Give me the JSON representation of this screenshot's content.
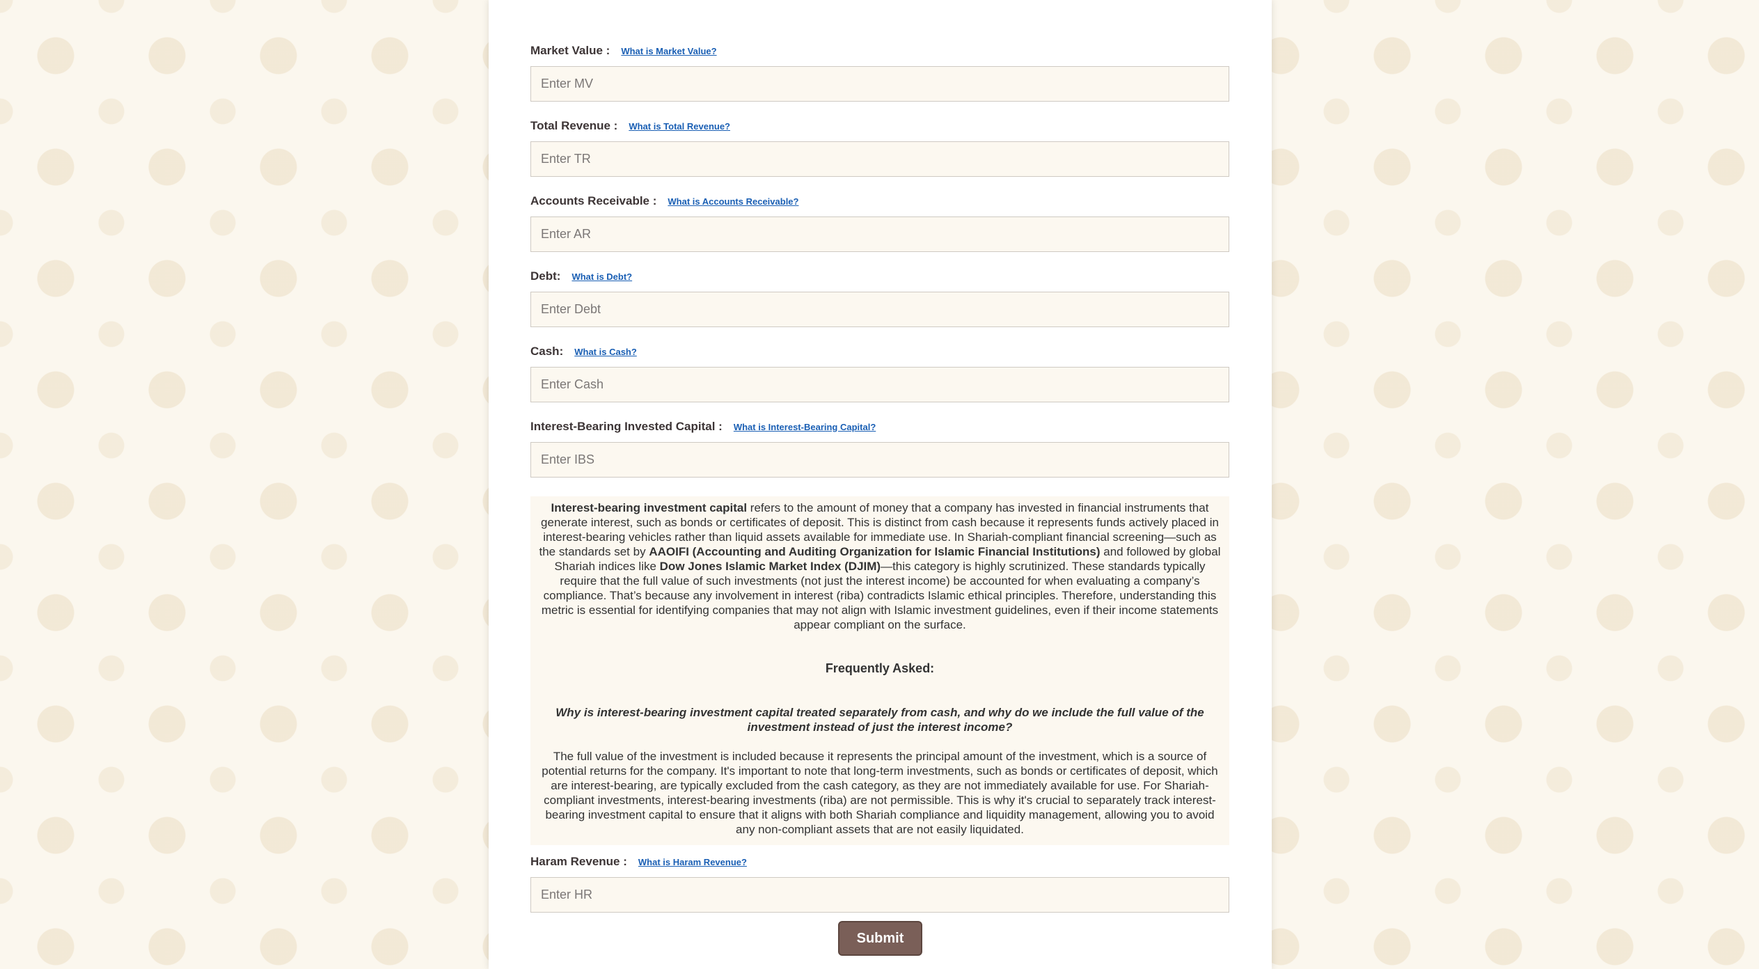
{
  "fields": [
    {
      "label": "Market Value :",
      "link": "What is Market Value?",
      "placeholder": "Enter MV"
    },
    {
      "label": "Total Revenue :",
      "link": "What is Total Revenue?",
      "placeholder": "Enter TR"
    },
    {
      "label": "Accounts Receivable :",
      "link": "What is Accounts Receivable?",
      "placeholder": "Enter AR"
    },
    {
      "label": "Debt:",
      "link": "What is Debt?",
      "placeholder": "Enter Debt"
    },
    {
      "label": "Cash:",
      "link": "What is Cash?",
      "placeholder": "Enter Cash"
    },
    {
      "label": "Interest-Bearing Invested Capital :",
      "link": "What is Interest-Bearing Capital?",
      "placeholder": "Enter IBS"
    }
  ],
  "info": {
    "term": "Interest-bearing investment capital",
    "text1": " refers to the amount of money that a company has invested in financial instruments that generate interest, such as bonds or certificates of deposit. This is distinct from cash because it represents funds actively placed in interest-bearing vehicles rather than liquid assets available for immediate use. In Shariah-compliant financial screening—such as the standards set by ",
    "aaoifi": "AAOIFI (Accounting and Auditing Organization for Islamic Financial Institutions)",
    "text2": " and followed by global Shariah indices like ",
    "djim": "Dow Jones Islamic Market Index (DJIM)",
    "text3": "—this category is highly scrutinized. These standards typically require that the full value of such investments (not just the interest income) be accounted for when evaluating a company’s compliance. That’s because any involvement in interest (riba) contradicts Islamic ethical principles. Therefore, understanding this metric is essential for identifying companies that may not align with Islamic investment guidelines, even if their income statements appear compliant on the surface.",
    "faq_heading": "Frequently Asked:",
    "faq_question": "Why is interest-bearing investment capital treated separately from cash, and why do we include the full value of the investment instead of just the interest income?",
    "faq_answer": "The full value of the investment is included because it represents the principal amount of the investment, which is a source of potential returns for the company. It's important to note that long-term investments, such as bonds or certificates of deposit, which are interest-bearing, are typically excluded from the cash category, as they are not immediately available for use. For Shariah-compliant investments, interest-bearing investments (riba) are not permissible. This is why it's crucial to separately track interest-bearing investment capital to ensure that it aligns with both Shariah compliance and liquidity management, allowing you to avoid any non-compliant assets that are not easily liquidated."
  },
  "haram": {
    "label": "Haram Revenue :",
    "link": "What is Haram Revenue?",
    "placeholder": "Enter HR"
  },
  "submit_label": "Submit"
}
